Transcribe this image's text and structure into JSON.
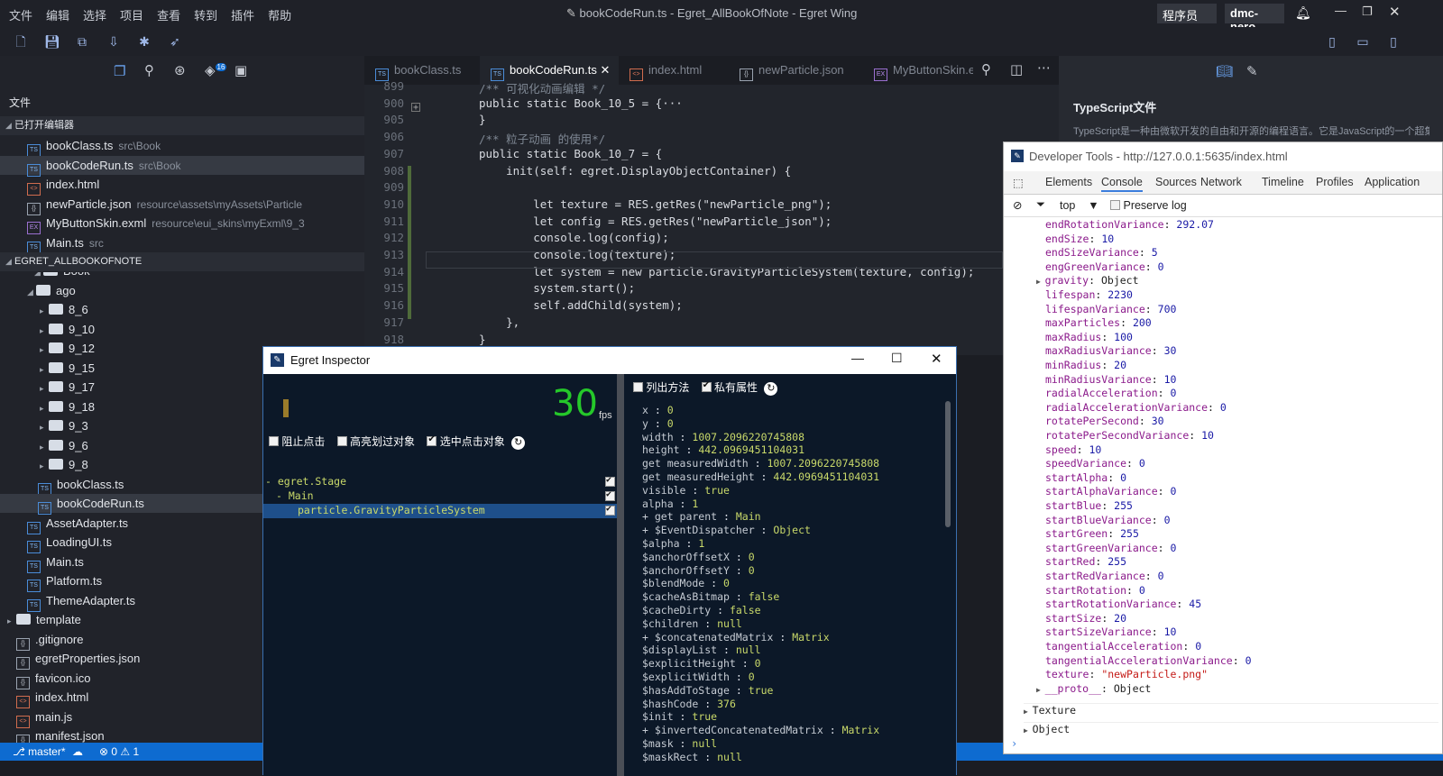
{
  "titlebar": {
    "menu": [
      "文件",
      "编辑",
      "选择",
      "项目",
      "查看",
      "转到",
      "插件",
      "帮助"
    ],
    "title": "bookCodeRun.ts - Egret_AllBookOfNote - Egret Wing",
    "role": "程序员 ▼",
    "user": "dmc-nero"
  },
  "leftpane": {
    "section_files": "文件",
    "open_editors": "已打开编辑器",
    "project": "EGRET_ALLBOOKOFNOTE",
    "open": [
      {
        "name": "bookClass.ts",
        "hint": "src\\Book",
        "type": "ts"
      },
      {
        "name": "bookCodeRun.ts",
        "hint": "src\\Book",
        "type": "ts"
      },
      {
        "name": "index.html",
        "hint": "",
        "type": "html"
      },
      {
        "name": "newParticle.json",
        "hint": "resource\\assets\\myAssets\\Particle",
        "type": "json"
      },
      {
        "name": "MyButtonSkin.exml",
        "hint": "resource\\eui_skins\\myExml\\9_3",
        "type": "xml"
      },
      {
        "name": "Main.ts",
        "hint": "src",
        "type": "ts"
      }
    ],
    "tree": [
      {
        "name": "Book",
        "kind": "folder"
      },
      {
        "name": "ago",
        "kind": "folder"
      },
      {
        "name": "8_6",
        "kind": "folder"
      },
      {
        "name": "9_10",
        "kind": "folder"
      },
      {
        "name": "9_12",
        "kind": "folder"
      },
      {
        "name": "9_15",
        "kind": "folder"
      },
      {
        "name": "9_17",
        "kind": "folder"
      },
      {
        "name": "9_18",
        "kind": "folder"
      },
      {
        "name": "9_3",
        "kind": "folder"
      },
      {
        "name": "9_6",
        "kind": "folder"
      },
      {
        "name": "9_8",
        "kind": "folder"
      },
      {
        "name": "bookClass.ts",
        "kind": "ts"
      },
      {
        "name": "bookCodeRun.ts",
        "kind": "ts"
      },
      {
        "name": "AssetAdapter.ts",
        "kind": "ts"
      },
      {
        "name": "LoadingUI.ts",
        "kind": "ts"
      },
      {
        "name": "Main.ts",
        "kind": "ts"
      },
      {
        "name": "Platform.ts",
        "kind": "ts"
      },
      {
        "name": "ThemeAdapter.ts",
        "kind": "ts"
      },
      {
        "name": "template",
        "kind": "folder"
      },
      {
        "name": ".gitignore",
        "kind": "json"
      },
      {
        "name": "egretProperties.json",
        "kind": "json"
      },
      {
        "name": "favicon.ico",
        "kind": "json"
      },
      {
        "name": "index.html",
        "kind": "html"
      },
      {
        "name": "main.js",
        "kind": "html"
      },
      {
        "name": "manifest.json",
        "kind": "json"
      }
    ]
  },
  "tabs": [
    "bookClass.ts",
    "bookCodeRun.ts",
    "index.html",
    "newParticle.json",
    "MyButtonSkin.exml"
  ],
  "editor": {
    "lines": [
      {
        "n": "899",
        "t": "/** 可视化动画编辑 */"
      },
      {
        "n": "900",
        "t": "public static Book_10_5 = {···"
      },
      {
        "n": "905",
        "t": "}"
      },
      {
        "n": "906",
        "t": "/** 粒子动画 的使用*/"
      },
      {
        "n": "907",
        "t": "public static Book_10_7 = {"
      },
      {
        "n": "908",
        "t": "    init(self: egret.DisplayObjectContainer) {"
      },
      {
        "n": "909",
        "t": ""
      },
      {
        "n": "910",
        "t": "        let texture = RES.getRes(\"newParticle_png\");"
      },
      {
        "n": "911",
        "t": "        let config = RES.getRes(\"newParticle_json\");"
      },
      {
        "n": "912",
        "t": "        console.log(config);"
      },
      {
        "n": "913",
        "t": "        console.log(texture);"
      },
      {
        "n": "914",
        "t": "        let system = new particle.GravityParticleSystem(texture, config);"
      },
      {
        "n": "915",
        "t": "        system.start();"
      },
      {
        "n": "916",
        "t": "        self.addChild(system);"
      },
      {
        "n": "917",
        "t": "    },"
      },
      {
        "n": "918",
        "t": "}"
      }
    ]
  },
  "rightpane": {
    "title": "TypeScript文件",
    "desc": "TypeScript是一种由微软开发的自由和开源的编程语言。它是JavaScript的一个超集"
  },
  "statusbar": {
    "branch": "master*",
    "errors": "0",
    "warnings": "1"
  },
  "inspector": {
    "title": "Egret Inspector",
    "fps": "30",
    "fps_unit": "fps",
    "opt1": "阻止点击",
    "opt2": "高亮划过对象",
    "opt3": "选中点击对象",
    "list_methods": "列出方法",
    "private_props": "私有属性",
    "tree": [
      "- egret.Stage",
      "- Main",
      "particle.GravityParticleSystem"
    ],
    "props": [
      [
        "x",
        "0"
      ],
      [
        "y",
        "0"
      ],
      [
        "width",
        "1007.2096220745808"
      ],
      [
        "height",
        "442.0969451104031"
      ],
      [
        "get measuredWidth",
        "1007.2096220745808"
      ],
      [
        "get measuredHeight",
        "442.0969451104031"
      ],
      [
        "visible",
        "true"
      ],
      [
        "alpha",
        "1"
      ],
      [
        "+ get parent",
        "Main"
      ],
      [
        "+ $EventDispatcher",
        "Object"
      ],
      [
        "$alpha",
        "1"
      ],
      [
        "$anchorOffsetX",
        "0"
      ],
      [
        "$anchorOffsetY",
        "0"
      ],
      [
        "$blendMode",
        "0"
      ],
      [
        "$cacheAsBitmap",
        "false"
      ],
      [
        "$cacheDirty",
        "false"
      ],
      [
        "$children",
        "null"
      ],
      [
        "+ $concatenatedMatrix",
        "Matrix"
      ],
      [
        "$displayList",
        "null"
      ],
      [
        "$explicitHeight",
        "0"
      ],
      [
        "$explicitWidth",
        "0"
      ],
      [
        "$hasAddToStage",
        "true"
      ],
      [
        "$hashCode",
        "376"
      ],
      [
        "$init",
        "true"
      ],
      [
        "+ $invertedConcatenatedMatrix",
        "Matrix"
      ],
      [
        "$mask",
        "null"
      ],
      [
        "$maskRect",
        "null"
      ]
    ]
  },
  "devtools": {
    "title": "Developer Tools - http://127.0.0.1:5635/index.html",
    "tabs": [
      "Elements",
      "Console",
      "Sources",
      "Network",
      "Timeline",
      "Profiles",
      "Application"
    ],
    "context": "top",
    "preserve": "Preserve log",
    "lines": [
      [
        "endRotationVariance",
        "292.07",
        "n"
      ],
      [
        "endSize",
        "10",
        "n"
      ],
      [
        "endSizeVariance",
        "5",
        "n"
      ],
      [
        "engGreenVariance",
        "0",
        "n"
      ],
      [
        "gravity",
        "Object",
        "o"
      ],
      [
        "lifespan",
        "2230",
        "n"
      ],
      [
        "lifespanVariance",
        "700",
        "n"
      ],
      [
        "maxParticles",
        "200",
        "n"
      ],
      [
        "maxRadius",
        "100",
        "n"
      ],
      [
        "maxRadiusVariance",
        "30",
        "n"
      ],
      [
        "minRadius",
        "20",
        "n"
      ],
      [
        "minRadiusVariance",
        "10",
        "n"
      ],
      [
        "radialAcceleration",
        "0",
        "n"
      ],
      [
        "radialAccelerationVariance",
        "0",
        "n"
      ],
      [
        "rotatePerSecond",
        "30",
        "n"
      ],
      [
        "rotatePerSecondVariance",
        "10",
        "n"
      ],
      [
        "speed",
        "10",
        "n"
      ],
      [
        "speedVariance",
        "0",
        "n"
      ],
      [
        "startAlpha",
        "0",
        "n"
      ],
      [
        "startAlphaVariance",
        "0",
        "n"
      ],
      [
        "startBlue",
        "255",
        "n"
      ],
      [
        "startBlueVariance",
        "0",
        "n"
      ],
      [
        "startGreen",
        "255",
        "n"
      ],
      [
        "startGreenVariance",
        "0",
        "n"
      ],
      [
        "startRed",
        "255",
        "n"
      ],
      [
        "startRedVariance",
        "0",
        "n"
      ],
      [
        "startRotation",
        "0",
        "n"
      ],
      [
        "startRotationVariance",
        "45",
        "n"
      ],
      [
        "startSize",
        "20",
        "n"
      ],
      [
        "startSizeVariance",
        "10",
        "n"
      ],
      [
        "tangentialAcceleration",
        "0",
        "n"
      ],
      [
        "tangentialAccelerationVariance",
        "0",
        "n"
      ],
      [
        "texture",
        "\"newParticle.png\"",
        "s"
      ],
      [
        "__proto__",
        "Object",
        "o"
      ]
    ],
    "entries": [
      "Texture",
      "Object"
    ]
  }
}
